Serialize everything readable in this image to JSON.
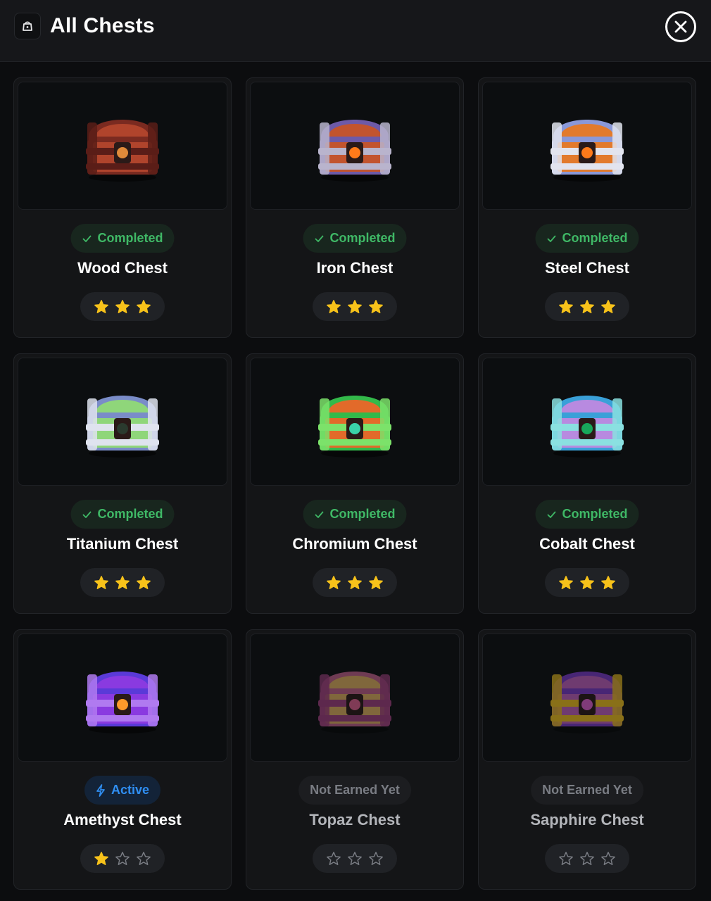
{
  "header": {
    "title": "All Chests",
    "icon": "chest-icon"
  },
  "colors": {
    "completed": "#3fb866",
    "active": "#2f8ef2",
    "star": "#f7c21a",
    "star_empty": "#7a7d84"
  },
  "chests": [
    {
      "name": "Wood Chest",
      "status": "completed",
      "status_label": "Completed",
      "stars": 3,
      "palette": [
        "#7a2a20",
        "#b0442c",
        "#5a1d18",
        "#e08a3a"
      ]
    },
    {
      "name": "Iron Chest",
      "status": "completed",
      "status_label": "Completed",
      "stars": 3,
      "palette": [
        "#6d5aa8",
        "#c2542e",
        "#b8b4cc",
        "#ff7a1a"
      ]
    },
    {
      "name": "Steel Chest",
      "status": "completed",
      "status_label": "Completed",
      "stars": 3,
      "palette": [
        "#8a98d8",
        "#e27a2c",
        "#e2e4ee",
        "#ff7a1a"
      ]
    },
    {
      "name": "Titanium Chest",
      "status": "completed",
      "status_label": "Completed",
      "stars": 3,
      "palette": [
        "#7a8cc8",
        "#8fd67a",
        "#dfe3ee",
        "#2a3a2e"
      ]
    },
    {
      "name": "Chromium Chest",
      "status": "completed",
      "status_label": "Completed",
      "stars": 3,
      "palette": [
        "#33b94a",
        "#e26a2a",
        "#7ce26a",
        "#3ad2a8"
      ]
    },
    {
      "name": "Cobalt Chest",
      "status": "completed",
      "status_label": "Completed",
      "stars": 3,
      "palette": [
        "#3aa0d8",
        "#b88ae0",
        "#8ae0e0",
        "#18a85a"
      ]
    },
    {
      "name": "Amethyst Chest",
      "status": "active",
      "status_label": "Active",
      "stars": 1,
      "palette": [
        "#5a3ad8",
        "#8a3ae0",
        "#b07af0",
        "#ff9a2a"
      ]
    },
    {
      "name": "Topaz Chest",
      "status": "locked",
      "status_label": "Not Earned Yet",
      "stars": 0,
      "palette": [
        "#c0608a",
        "#e0b060",
        "#a04080",
        "#e06090"
      ]
    },
    {
      "name": "Sapphire Chest",
      "status": "locked",
      "status_label": "Not Earned Yet",
      "stars": 0,
      "palette": [
        "#7a3ac8",
        "#c060c0",
        "#f0c020",
        "#e060d0"
      ]
    }
  ]
}
